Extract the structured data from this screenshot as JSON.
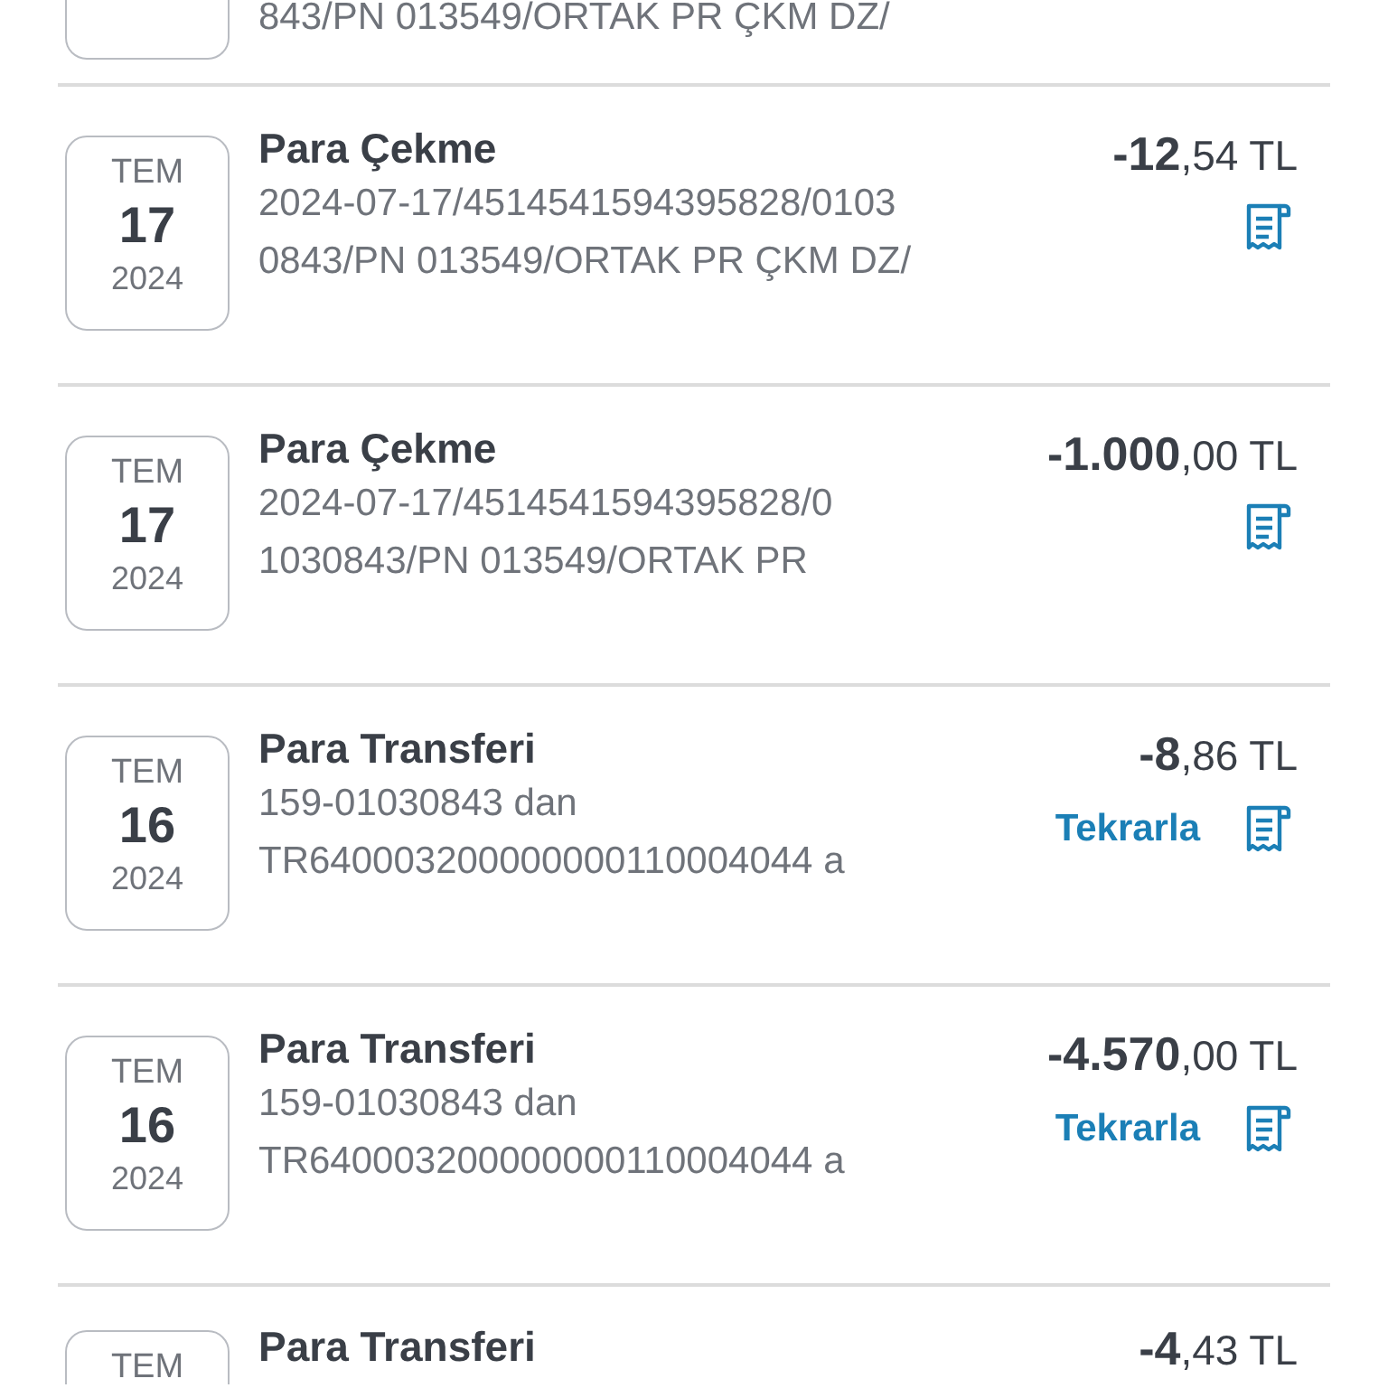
{
  "transactions": [
    {
      "kind": "partial-top",
      "description": [
        "843/PN 013549/ORTAK PR ÇKM DZ/"
      ]
    },
    {
      "kind": "full",
      "month": "TEM",
      "day": "17",
      "year": "2024",
      "title": "Para Çekme",
      "description": [
        "2024-07-17/4514541594395828/0103",
        "0843/PN 013549/ORTAK PR ÇKM DZ/"
      ],
      "amount": "**-12**,54 TL"
    },
    {
      "kind": "full",
      "month": "TEM",
      "day": "17",
      "year": "2024",
      "title": "Para Çekme",
      "description": [
        "2024-07-17/4514541594395828/0",
        "1030843/PN 013549/ORTAK PR"
      ],
      "amount": "**-1.000**,00 TL"
    },
    {
      "kind": "full",
      "month": "TEM",
      "day": "16",
      "year": "2024",
      "title": "Para Transferi",
      "description": [
        "159-01030843 dan",
        "TR640003200000000110004044 a"
      ],
      "amount": "**-8**,86 TL",
      "repeat": "Tekrarla"
    },
    {
      "kind": "full",
      "month": "TEM",
      "day": "16",
      "year": "2024",
      "title": "Para Transferi",
      "description": [
        "159-01030843 dan",
        "TR640003200000000110004044 a"
      ],
      "amount": "**-4.570**,00 TL",
      "repeat": "Tekrarla"
    },
    {
      "kind": "partial-bottom",
      "month": "TEM",
      "title": "Para Transferi",
      "amount": "**-4**,43 TL"
    }
  ]
}
